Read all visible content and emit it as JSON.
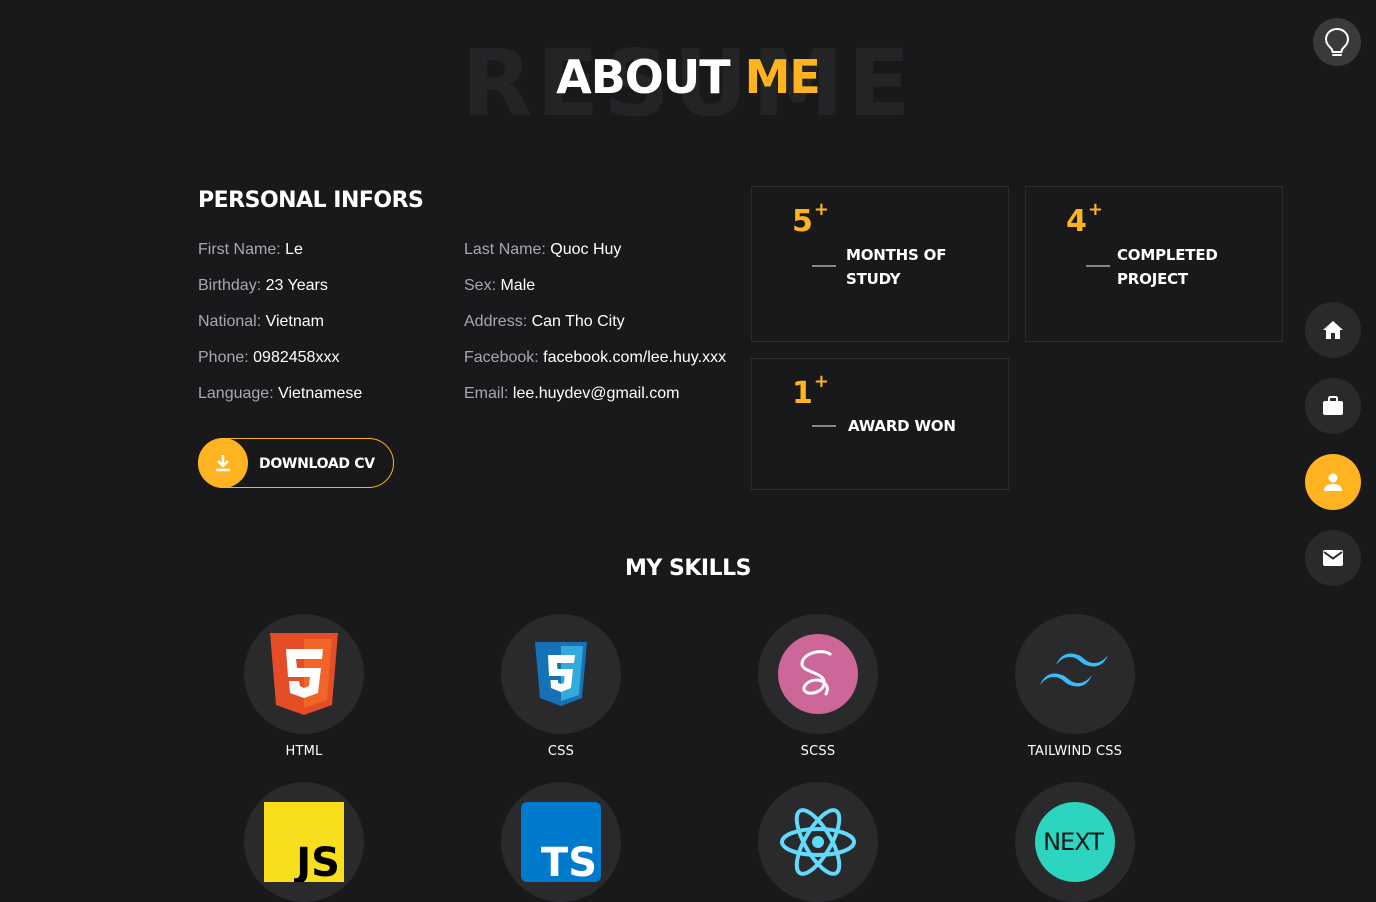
{
  "header": {
    "background_word": "RESUME",
    "title_main": "ABOUT",
    "title_accent": "ME"
  },
  "colors": {
    "accent": "#ffb321",
    "background": "#19191c"
  },
  "theme_toggle": {
    "icon": "lightbulb-icon"
  },
  "nav": [
    {
      "id": "home",
      "icon": "home-icon",
      "active": false
    },
    {
      "id": "portfolio",
      "icon": "briefcase-icon",
      "active": false
    },
    {
      "id": "about",
      "icon": "user-icon",
      "active": true
    },
    {
      "id": "contact",
      "icon": "mail-icon",
      "active": false
    }
  ],
  "personal": {
    "title": "PERSONAL INFORS",
    "left": [
      {
        "key": "First Name: ",
        "value": "Le"
      },
      {
        "key": "Birthday: ",
        "value": "23 Years"
      },
      {
        "key": "National: ",
        "value": "Vietnam"
      },
      {
        "key": "Phone: ",
        "value": "0982458xxx"
      },
      {
        "key": "Language: ",
        "value": "Vietnamese"
      }
    ],
    "right": [
      {
        "key": "Last Name: ",
        "value": "Quoc Huy"
      },
      {
        "key": "Sex: ",
        "value": "Male"
      },
      {
        "key": "Address: ",
        "value": "Can Tho City"
      },
      {
        "key": "Facebook: ",
        "value": "facebook.com/lee.huy.xxx"
      },
      {
        "key": "Email: ",
        "value": "lee.huydev@gmail.com"
      }
    ],
    "download_label": "DOWNLOAD CV"
  },
  "stats": [
    {
      "number": "5",
      "plus": "+",
      "line1": "MONTHS OF",
      "line2": "STUDY"
    },
    {
      "number": "4",
      "plus": "+",
      "line1": "COMPLETED",
      "line2": "PROJECT"
    },
    {
      "number": "1",
      "plus": "+",
      "line1": "AWARD WON",
      "line2": ""
    }
  ],
  "skills": {
    "title": "MY SKILLS",
    "items": [
      {
        "name": "HTML",
        "icon": "html5-icon"
      },
      {
        "name": "CSS",
        "icon": "css3-icon"
      },
      {
        "name": "SCSS",
        "icon": "sass-icon"
      },
      {
        "name": "TAILWIND CSS",
        "icon": "tailwind-icon"
      },
      {
        "name": "JS",
        "icon": "javascript-icon"
      },
      {
        "name": "TS",
        "icon": "typescript-icon"
      },
      {
        "name": "",
        "icon": "react-icon"
      },
      {
        "name": "NEXT",
        "icon": "nextjs-icon"
      }
    ]
  }
}
